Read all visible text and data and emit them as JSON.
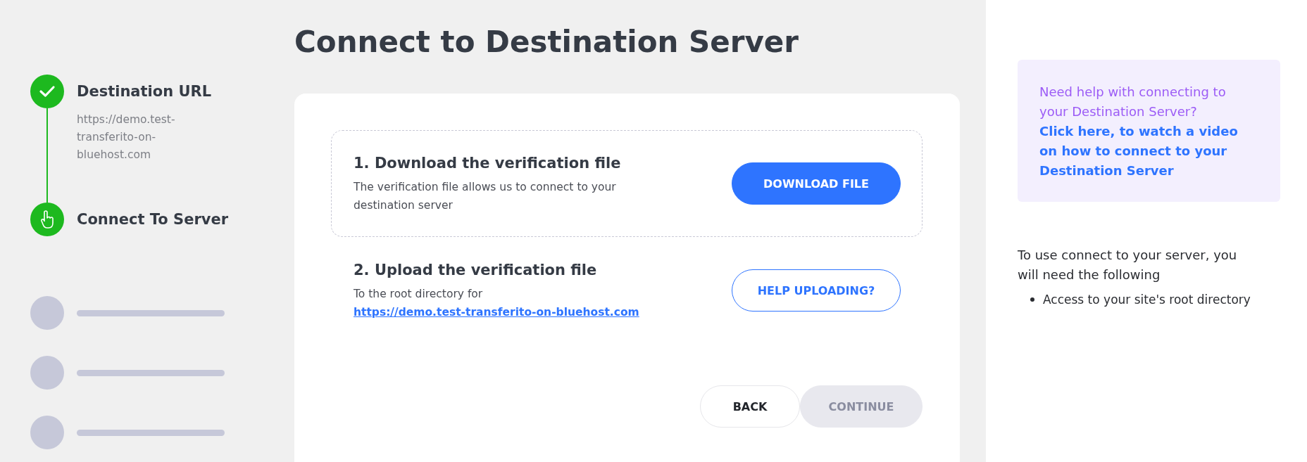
{
  "title": "Connect to Destination Server",
  "steps": [
    {
      "kind": "done",
      "label": "Destination URL",
      "detail": "https://demo.test-transferito-on-bluehost.com"
    },
    {
      "kind": "current",
      "label": "Connect To Server"
    },
    {
      "kind": "pending"
    },
    {
      "kind": "pending"
    },
    {
      "kind": "pending"
    }
  ],
  "tasks": [
    {
      "heading": "1. Download the verification file",
      "text": "The verification file allows us to connect to your destination server",
      "button": {
        "label": "DOWNLOAD FILE",
        "kind": "primary"
      },
      "highlighted": true
    },
    {
      "heading": "2. Upload the verification file",
      "text": "To the root directory for",
      "link": "https://demo.test-transferito-on-bluehost.com",
      "button": {
        "label": "HELP UPLOADING?",
        "kind": "outline"
      },
      "highlighted": false
    }
  ],
  "actions": [
    {
      "label": "BACK",
      "disabled": false
    },
    {
      "label": "CONTINUE",
      "disabled": true
    }
  ],
  "help": {
    "question": "Need help with connecting to your Destination Server?",
    "link": "Click here, to watch a video on how to connect to your Destination Server"
  },
  "requirements": {
    "intro": "To use connect to your server, you will need the following",
    "items": [
      "Access to your site's root directory"
    ]
  }
}
